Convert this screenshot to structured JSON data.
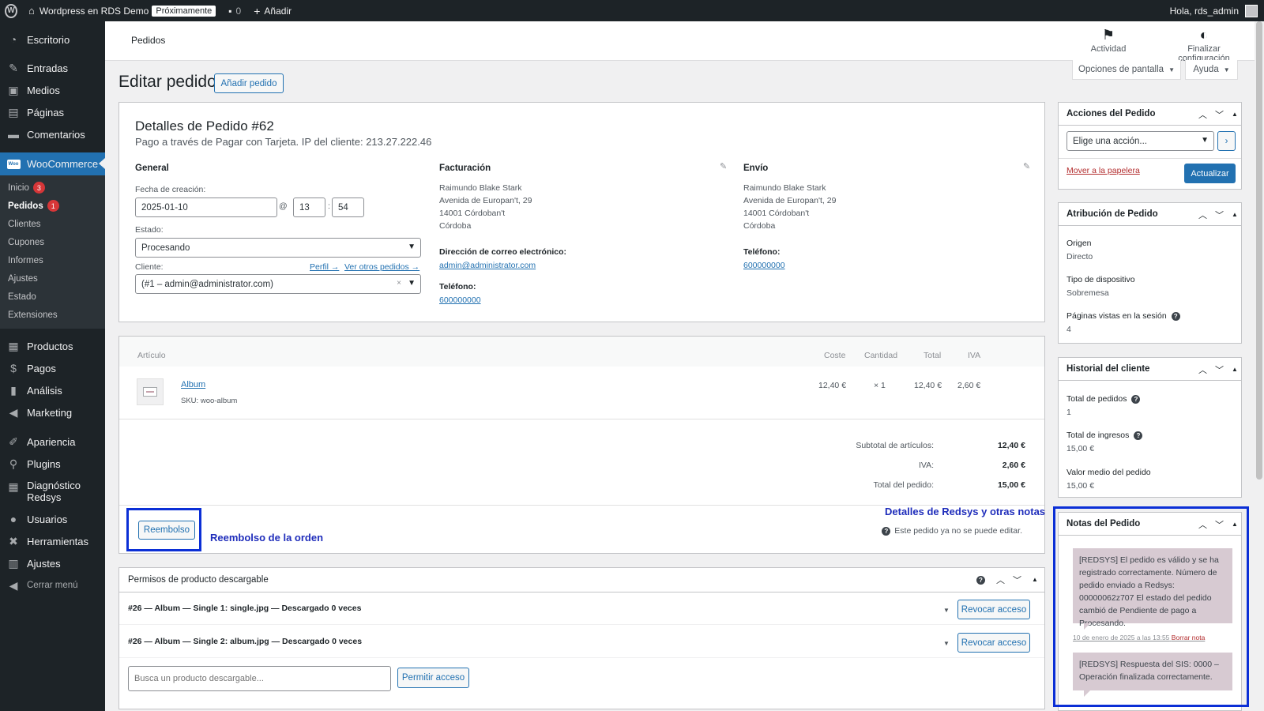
{
  "adminbar": {
    "site_name": "Wordpress en RDS Demo",
    "coming_soon": "Próximamente",
    "comments_count": "0",
    "add_new": "Añadir",
    "greeting": "Hola, rds_admin"
  },
  "sidebar": {
    "items_top": [
      "Escritorio",
      "Entradas",
      "Medios",
      "Páginas",
      "Comentarios"
    ],
    "woocommerce": "WooCommerce",
    "woo_sub": [
      {
        "label": "Inicio",
        "badge": "3"
      },
      {
        "label": "Pedidos",
        "badge": "1"
      },
      {
        "label": "Clientes"
      },
      {
        "label": "Cupones"
      },
      {
        "label": "Informes"
      },
      {
        "label": "Ajustes"
      },
      {
        "label": "Estado"
      },
      {
        "label": "Extensiones"
      }
    ],
    "items_bottom": [
      "Productos",
      "Pagos",
      "Análisis",
      "Marketing",
      "Apariencia",
      "Plugins",
      "Diagnóstico Redsys",
      "Usuarios",
      "Herramientas",
      "Ajustes",
      "Cerrar menú"
    ]
  },
  "header": {
    "title": "Pedidos",
    "activity": "Actividad",
    "finish_setup": "Finalizar configuración",
    "screen_options": "Opciones de pantalla",
    "help": "Ayuda"
  },
  "page": {
    "title": "Editar pedido",
    "add_order": "Añadir pedido"
  },
  "order": {
    "heading": "Detalles de Pedido #62",
    "meta": "Pago a través de Pagar con Tarjeta. IP del cliente: 213.27.222.46",
    "general": {
      "title": "General",
      "created_label": "Fecha de creación:",
      "date": "2025-01-10",
      "hour": "13",
      "minute": "54",
      "at": "@",
      "status_label": "Estado:",
      "status": "Procesando",
      "customer_label": "Cliente:",
      "profile_link": "Perfil →",
      "other_orders_link": "Ver otros pedidos →",
      "customer": "(#1 – admin@administrator.com)"
    },
    "billing": {
      "title": "Facturación",
      "address": [
        "Raimundo Blake Stark",
        "Avenida de Europan't, 29",
        "14001 Córdoban't",
        "Córdoba"
      ],
      "email_label": "Dirección de correo electrónico:",
      "email": "admin@administrator.com",
      "phone_label": "Teléfono:",
      "phone": "600000000"
    },
    "shipping": {
      "title": "Envío",
      "address": [
        "Raimundo Blake Stark",
        "Avenida de Europan't, 29",
        "14001 Córdoban't",
        "Córdoba"
      ],
      "phone_label": "Teléfono:",
      "phone": "600000000"
    }
  },
  "items": {
    "headers": {
      "item": "Artículo",
      "cost": "Coste",
      "qty": "Cantidad",
      "total": "Total",
      "tax": "IVA"
    },
    "rows": [
      {
        "name": "Album",
        "sku_label": "SKU:",
        "sku": "woo-album",
        "cost": "12,40 €",
        "qty": "× 1",
        "total": "12,40 €",
        "tax": "2,60 €"
      }
    ],
    "totals": [
      {
        "label": "Subtotal de artículos:",
        "value": "12,40 €"
      },
      {
        "label": "IVA:",
        "value": "2,60 €"
      },
      {
        "label": "Total del pedido:",
        "value": "15,00 €"
      }
    ],
    "refund_button": "Reembolso",
    "not_editable": "Este pedido ya no se puede editar."
  },
  "annotations": {
    "refund": "Reembolso de la orden",
    "notes": "Detalles de Redsys y otras notas"
  },
  "downloads": {
    "title": "Permisos de producto descargable",
    "rows": [
      {
        "label": "#26 — Album — Single 1: single.jpg — Descargado 0 veces",
        "revoke": "Revocar acceso"
      },
      {
        "label": "#26 — Album — Single 2: album.jpg — Descargado 0 veces",
        "revoke": "Revocar acceso"
      }
    ],
    "search_placeholder": "Busca un producto descargable...",
    "grant": "Permitir acceso"
  },
  "actions_box": {
    "title": "Acciones del Pedido",
    "select": "Elige una acción...",
    "trash": "Mover a la papelera",
    "update": "Actualizar"
  },
  "attribution_box": {
    "title": "Atribución de Pedido",
    "origin_label": "Origen",
    "origin": "Directo",
    "device_label": "Tipo de dispositivo",
    "device": "Sobremesa",
    "pages_label": "Páginas vistas en la sesión",
    "pages": "4"
  },
  "history_box": {
    "title": "Historial del cliente",
    "orders_label": "Total de pedidos",
    "orders": "1",
    "revenue_label": "Total de ingresos",
    "revenue": "15,00 €",
    "avg_label": "Valor medio del pedido",
    "avg": "15,00 €"
  },
  "notes_box": {
    "title": "Notas del Pedido",
    "notes": [
      {
        "text": "[REDSYS] El pedido es válido y se ha registrado correctamente. Número de pedido enviado a Redsys: 00000062z707 El estado del pedido cambió de Pendiente de pago a Procesando.",
        "date": "10 de enero de 2025 a las 13:55",
        "delete": "Borrar nota"
      },
      {
        "text": "[REDSYS] Respuesta del SIS: 0000 – Operación finalizada correctamente."
      }
    ]
  },
  "colors": {
    "accent": "#2271b1",
    "highlight": "#0b2fd6",
    "note_bg": "#d7cad2"
  }
}
